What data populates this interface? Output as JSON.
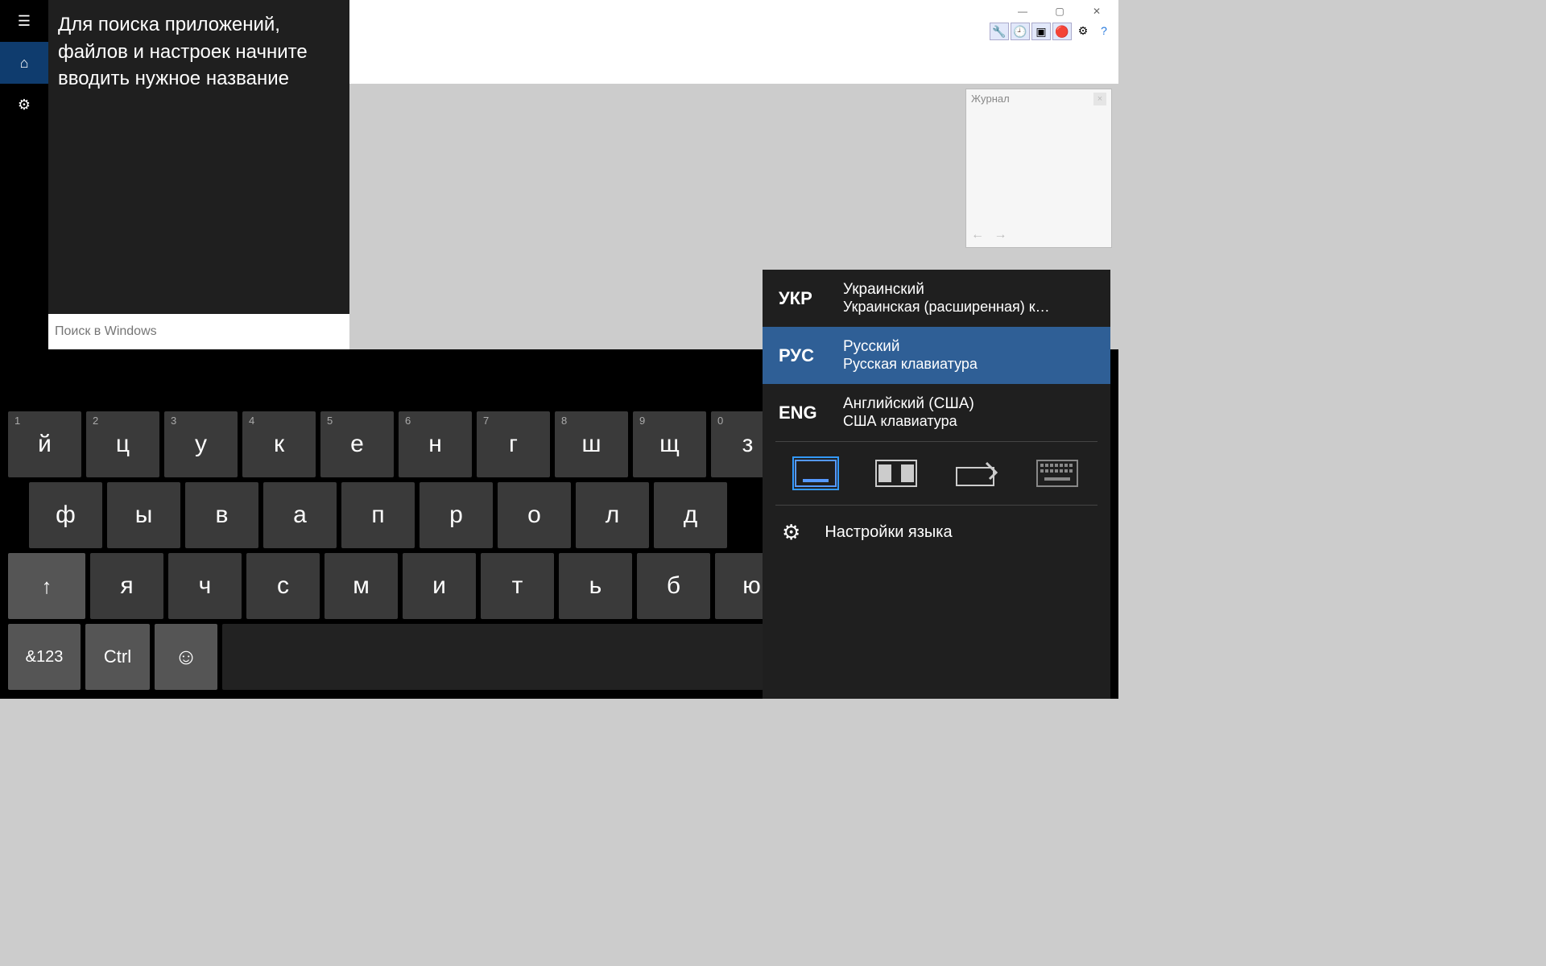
{
  "app": {
    "journal_title": "Жypнaл"
  },
  "windowControls": {
    "min": "—",
    "max": "▢",
    "close": "✕"
  },
  "start": {
    "hint": "Для поиска приложений, файлов и настроек начните вводить нужное название",
    "search_placeholder": "Поиск в Windows"
  },
  "languages": [
    {
      "code": "УКР",
      "name": "Украинский",
      "layout": "Украинская (расширенная) к…",
      "active": false
    },
    {
      "code": "РУС",
      "name": "Русский",
      "layout": "Русская клавиатура",
      "active": true
    },
    {
      "code": "ENG",
      "name": "Английский (США)",
      "layout": "США клавиатура",
      "active": false
    }
  ],
  "lang_settings": "Настройки языка",
  "nav_lang_code": "РУС",
  "keys": {
    "row1": [
      {
        "n": "1",
        "c": "й"
      },
      {
        "n": "2",
        "c": "ц"
      },
      {
        "n": "3",
        "c": "у"
      },
      {
        "n": "4",
        "c": "к"
      },
      {
        "n": "5",
        "c": "е"
      },
      {
        "n": "6",
        "c": "н"
      },
      {
        "n": "7",
        "c": "г"
      },
      {
        "n": "8",
        "c": "ш"
      },
      {
        "n": "9",
        "c": "щ"
      },
      {
        "n": "0",
        "c": "з"
      }
    ],
    "row2": [
      "ф",
      "ы",
      "в",
      "а",
      "п",
      "р",
      "о",
      "л",
      "д"
    ],
    "row3": [
      "я",
      "ч",
      "с",
      "м",
      "и",
      "т",
      "ь",
      "б",
      "ю"
    ],
    "sym": "&123",
    "ctrl": "Ctrl",
    "shift": "↑",
    "emoji": "☺",
    "left": "〈",
    "right": "〉"
  }
}
